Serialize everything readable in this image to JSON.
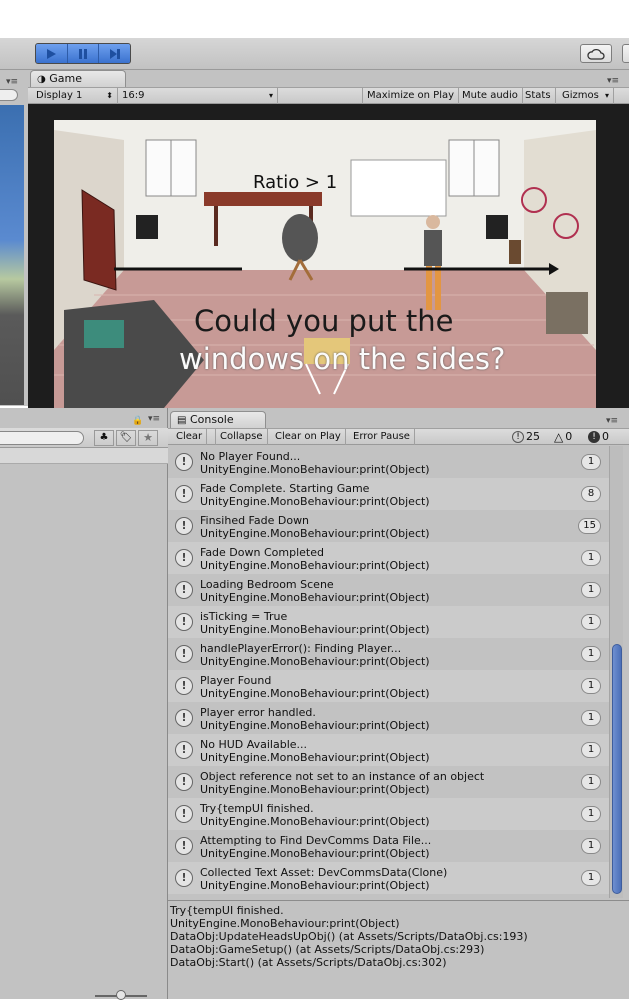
{
  "game_tab": {
    "label": "Game",
    "display": "Display 1",
    "aspect": "16:9",
    "maximize": "Maximize on Play",
    "mute": "Mute audio",
    "stats": "Stats",
    "gizmos": "Gizmos"
  },
  "game_scene": {
    "overlay_line1": "Could you put the",
    "overlay_line2": "windows on the sides?",
    "ratio_text": "Ratio > 1"
  },
  "console": {
    "tab_label": "Console",
    "toolbar": {
      "clear": "Clear",
      "collapse": "Collapse",
      "clear_on_play": "Clear on Play",
      "error_pause": "Error Pause"
    },
    "counts": {
      "logs": "25",
      "warnings": "0",
      "errors": "0"
    },
    "entries": [
      {
        "message": "No Player Found...",
        "source": "UnityEngine.MonoBehaviour:print(Object)",
        "count": "1"
      },
      {
        "message": "Fade Complete. Starting Game",
        "source": "UnityEngine.MonoBehaviour:print(Object)",
        "count": "8"
      },
      {
        "message": "Finsihed Fade Down",
        "source": "UnityEngine.MonoBehaviour:print(Object)",
        "count": "15"
      },
      {
        "message": "Fade Down Completed",
        "source": "UnityEngine.MonoBehaviour:print(Object)",
        "count": "1"
      },
      {
        "message": "Loading Bedroom Scene",
        "source": "UnityEngine.MonoBehaviour:print(Object)",
        "count": "1"
      },
      {
        "message": "isTicking = True",
        "source": "UnityEngine.MonoBehaviour:print(Object)",
        "count": "1"
      },
      {
        "message": "handlePlayerError(): Finding Player...",
        "source": "UnityEngine.MonoBehaviour:print(Object)",
        "count": "1"
      },
      {
        "message": "Player Found",
        "source": "UnityEngine.MonoBehaviour:print(Object)",
        "count": "1"
      },
      {
        "message": "Player error handled.",
        "source": "UnityEngine.MonoBehaviour:print(Object)",
        "count": "1"
      },
      {
        "message": "No HUD Available...",
        "source": "UnityEngine.MonoBehaviour:print(Object)",
        "count": "1"
      },
      {
        "message": "Object reference not set to an instance of an object",
        "source": "UnityEngine.MonoBehaviour:print(Object)",
        "count": "1"
      },
      {
        "message": "Try{tempUI finished.",
        "source": "UnityEngine.MonoBehaviour:print(Object)",
        "count": "1"
      },
      {
        "message": "Attempting to Find DevComms Data File...",
        "source": "UnityEngine.MonoBehaviour:print(Object)",
        "count": "1"
      },
      {
        "message": "Collected Text Asset: DevCommsData(Clone)",
        "source": "UnityEngine.MonoBehaviour:print(Object)",
        "count": "1"
      }
    ],
    "detail_lines": [
      "Try{tempUI finished.",
      "UnityEngine.MonoBehaviour:print(Object)",
      "DataObj:UpdateHeadsUpObj() (at Assets/Scripts/DataObj.cs:193)",
      "DataObj:GameSetup() (at Assets/Scripts/DataObj.cs:293)",
      "DataObj:Start() (at Assets/Scripts/DataObj.cs:302)"
    ]
  },
  "colors": {
    "accent": "#3f7ad8",
    "panel": "#c2c2c2",
    "row_alt": "#cbcbcb"
  },
  "icons": [
    "play-icon",
    "pause-icon",
    "step-icon",
    "cloud-icon",
    "info-icon",
    "warning-icon",
    "error-icon",
    "tag-icon",
    "star-icon",
    "lock-icon",
    "panel-menu-icon"
  ]
}
